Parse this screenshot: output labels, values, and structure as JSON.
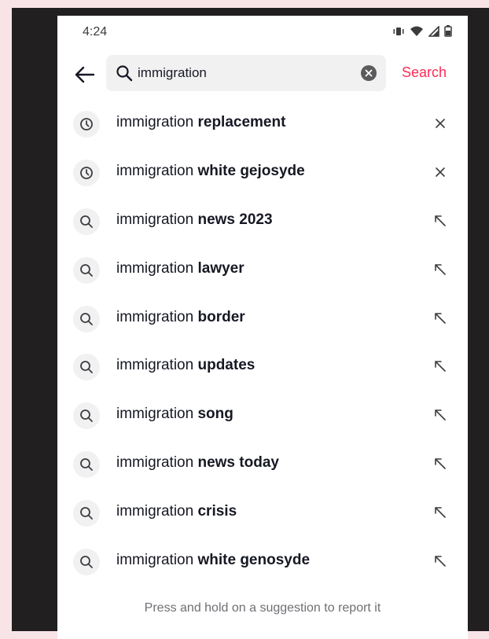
{
  "status_bar": {
    "time": "4:24",
    "icons": [
      "vibrate-icon",
      "wifi-icon",
      "signal-icon",
      "battery-icon"
    ]
  },
  "search": {
    "query": "immigration",
    "search_label": "Search",
    "accent_color": "#fe2c55"
  },
  "suggestions": [
    {
      "type": "history",
      "prefix": "immigration",
      "suffix": "replacement",
      "action": "remove"
    },
    {
      "type": "history",
      "prefix": "immigration",
      "suffix": "white gejosyde",
      "action": "remove"
    },
    {
      "type": "search",
      "prefix": "immigration",
      "suffix": "news 2023",
      "action": "fill"
    },
    {
      "type": "search",
      "prefix": "immigration",
      "suffix": "lawyer",
      "action": "fill"
    },
    {
      "type": "search",
      "prefix": "immigration",
      "suffix": "border",
      "action": "fill"
    },
    {
      "type": "search",
      "prefix": "immigration",
      "suffix": "updates",
      "action": "fill"
    },
    {
      "type": "search",
      "prefix": "immigration",
      "suffix": "song",
      "action": "fill"
    },
    {
      "type": "search",
      "prefix": "immigration",
      "suffix": "news today",
      "action": "fill"
    },
    {
      "type": "search",
      "prefix": "immigration",
      "suffix": "crisis",
      "action": "fill"
    },
    {
      "type": "search",
      "prefix": "immigration",
      "suffix": "white genosyde",
      "action": "fill"
    }
  ],
  "footer": {
    "note": "Press and hold on a suggestion to report it"
  }
}
